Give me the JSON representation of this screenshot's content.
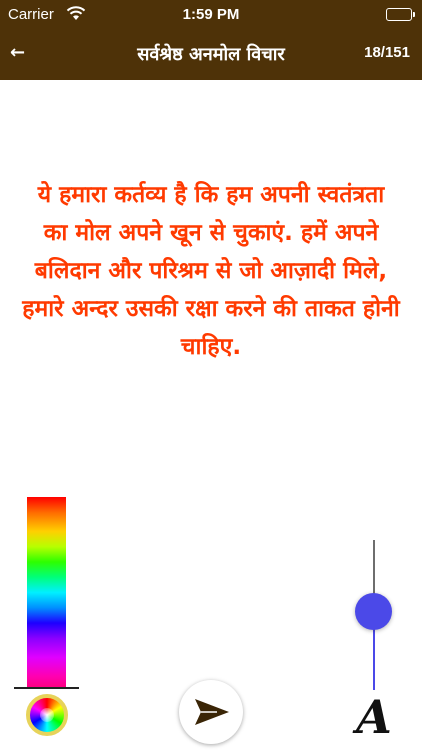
{
  "status_bar": {
    "carrier": "Carrier",
    "time": "1:59 PM",
    "wifi_icon": "wifi-icon",
    "battery_icon": "battery-icon"
  },
  "nav": {
    "back_label": "←",
    "title": "सर्वश्रेष्ठ अनमोल विचार",
    "counter": "18/151",
    "background_color": "#4e3208"
  },
  "quote": {
    "text": "ये हमारा कर्तव्य है कि हम अपनी स्वतंत्रता का मोल अपने खून से चुकाएं. हमें अपने बलिदान और परिश्रम से जो आज़ादी मिले, हमारे अन्दर उसकी रक्षा करने की ताकत होनी चाहिए.",
    "color": "#ff3a00"
  },
  "tools": {
    "color_picker_icon": "rainbow-gradient-bar",
    "color_wheel_icon": "color-wheel-icon",
    "send_icon": "paper-plane-icon",
    "font_size_label": "A",
    "font_slider_level": 0.52,
    "slider_color": "#4b49e8"
  }
}
